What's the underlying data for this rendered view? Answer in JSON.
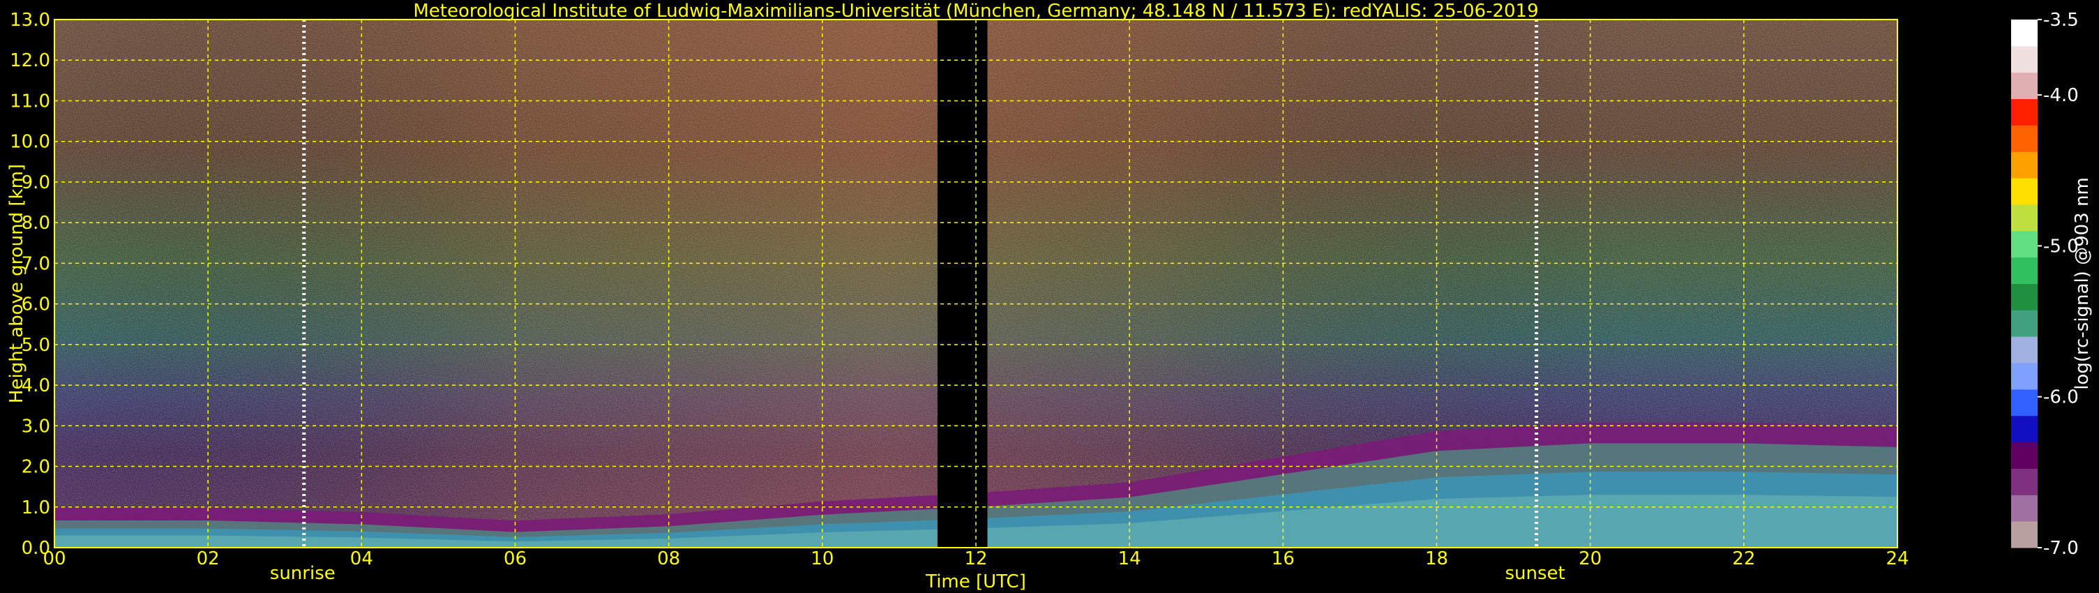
{
  "chart_data": {
    "type": "heatmap",
    "title": "Meteorological Institute of Ludwig-Maximilians-Universität (München, Germany; 48.148 N / 11.573 E):    redYALIS: 25-06-2019",
    "xlabel": "Time [UTC]",
    "ylabel": "Height above ground [km]",
    "xlim": [
      0,
      24
    ],
    "ylim": [
      0,
      13
    ],
    "x_ticks": [
      "00",
      "02",
      "04",
      "06",
      "08",
      "10",
      "12",
      "14",
      "16",
      "18",
      "20",
      "22",
      "24"
    ],
    "y_ticks": [
      "0.0",
      "1.0",
      "2.0",
      "3.0",
      "4.0",
      "5.0",
      "6.0",
      "7.0",
      "8.0",
      "9.0",
      "10.0",
      "11.0",
      "12.0",
      "13.0"
    ],
    "grid": true,
    "colorbar": {
      "label": "log(rc-signal) @903 nm",
      "range": [
        -7.0,
        -3.5
      ],
      "ticks": [
        "-3.5",
        "-4.0",
        "-5.0",
        "-6.0",
        "-7.0"
      ],
      "colors": [
        "#b8a0a0",
        "#a070a0",
        "#803080",
        "#600060",
        "#1010c0",
        "#3060ff",
        "#80a0ff",
        "#a0b0e0",
        "#40a080",
        "#209040",
        "#30c060",
        "#60e080",
        "#c0e040",
        "#ffe000",
        "#ffa000",
        "#ff6000",
        "#ff2000",
        "#e0b0b0",
        "#f0e0e0",
        "#ffffff"
      ]
    },
    "data_gap": {
      "start": 11.5,
      "end": 12.15
    },
    "events": [
      {
        "label": "sunrise",
        "time": 3.25
      },
      {
        "label": "sunset",
        "time": 19.3
      }
    ],
    "boundary_layer_height_km": [
      {
        "t": 0,
        "h": 0.6
      },
      {
        "t": 2,
        "h": 0.6
      },
      {
        "t": 4,
        "h": 0.5
      },
      {
        "t": 6,
        "h": 0.3
      },
      {
        "t": 8,
        "h": 0.45
      },
      {
        "t": 10,
        "h": 0.75
      },
      {
        "t": 12,
        "h": 0.95
      },
      {
        "t": 14,
        "h": 1.2
      },
      {
        "t": 16,
        "h": 1.8
      },
      {
        "t": 18,
        "h": 2.4
      },
      {
        "t": 20,
        "h": 2.6
      },
      {
        "t": 22,
        "h": 2.6
      },
      {
        "t": 24,
        "h": 2.5
      }
    ]
  }
}
